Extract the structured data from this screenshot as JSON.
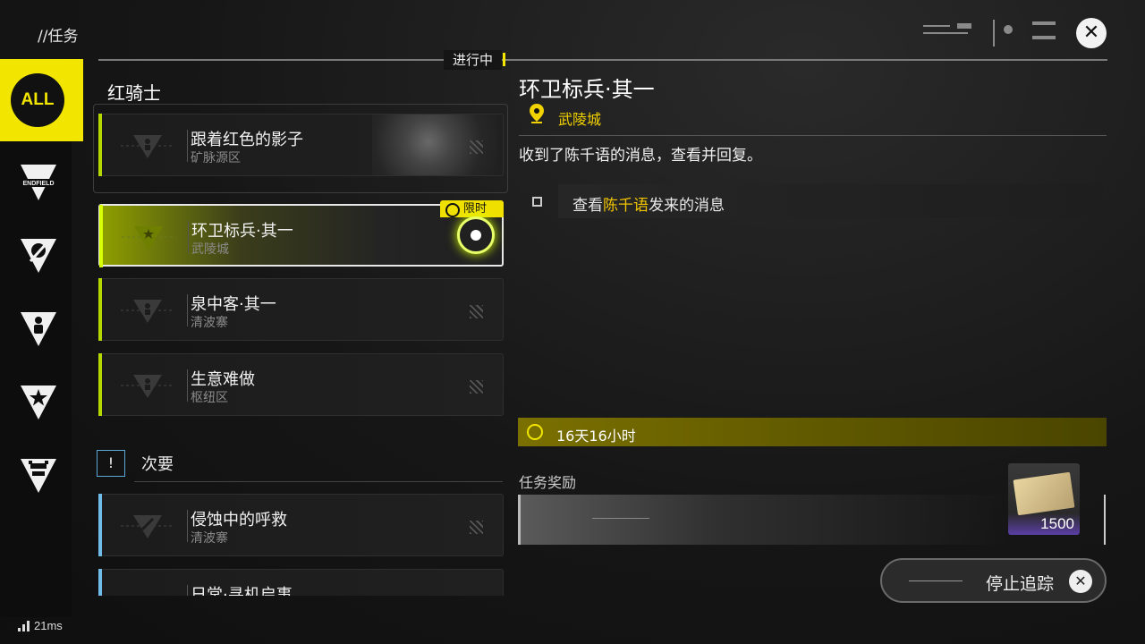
{
  "header": {
    "breadcrumb": "//任务",
    "status_label": "进行中",
    "close_icon": "close-icon"
  },
  "sidebar": {
    "items": [
      {
        "label": "ALL",
        "icon": "all-icon",
        "active": true
      },
      {
        "label": "ENDFIELD",
        "icon": "endfield-icon"
      },
      {
        "label": "",
        "icon": "pen-emblem-icon"
      },
      {
        "label": "",
        "icon": "person-emblem-icon"
      },
      {
        "label": "",
        "icon": "star-emblem-icon"
      },
      {
        "label": "",
        "icon": "cup-emblem-icon"
      }
    ]
  },
  "quest_list": {
    "main_group": {
      "title": "红骑士",
      "quests": [
        {
          "name": "跟着红色的影子",
          "location": "矿脉源区"
        }
      ]
    },
    "tracked": [
      {
        "name": "环卫标兵·其一",
        "location": "武陵城",
        "badge": "限时"
      },
      {
        "name": "泉中客·其一",
        "location": "清波寨"
      },
      {
        "name": "生意难做",
        "location": "枢纽区"
      }
    ],
    "secondary": {
      "label": "次要",
      "marker": "!",
      "quests": [
        {
          "name": "侵蚀中的呼救",
          "location": "清波寨"
        },
        {
          "name": "日常·寻机启事",
          "location": ""
        }
      ]
    }
  },
  "detail": {
    "title": "环卫标兵·其一",
    "location": "武陵城",
    "description": "收到了陈千语的消息，查看并回复。",
    "objective": {
      "prefix": "查看",
      "highlight": "陈千语",
      "suffix": "发来的消息"
    },
    "timer": "16天16小时",
    "reward_label": "任务奖励",
    "reward_quantity": "1500",
    "stop_button": "停止追踪"
  },
  "status": {
    "ping": "21ms"
  },
  "colors": {
    "accent_yellow": "#f2e600",
    "active_green": "#d7ff00",
    "secondary_blue": "#6fbde8"
  }
}
